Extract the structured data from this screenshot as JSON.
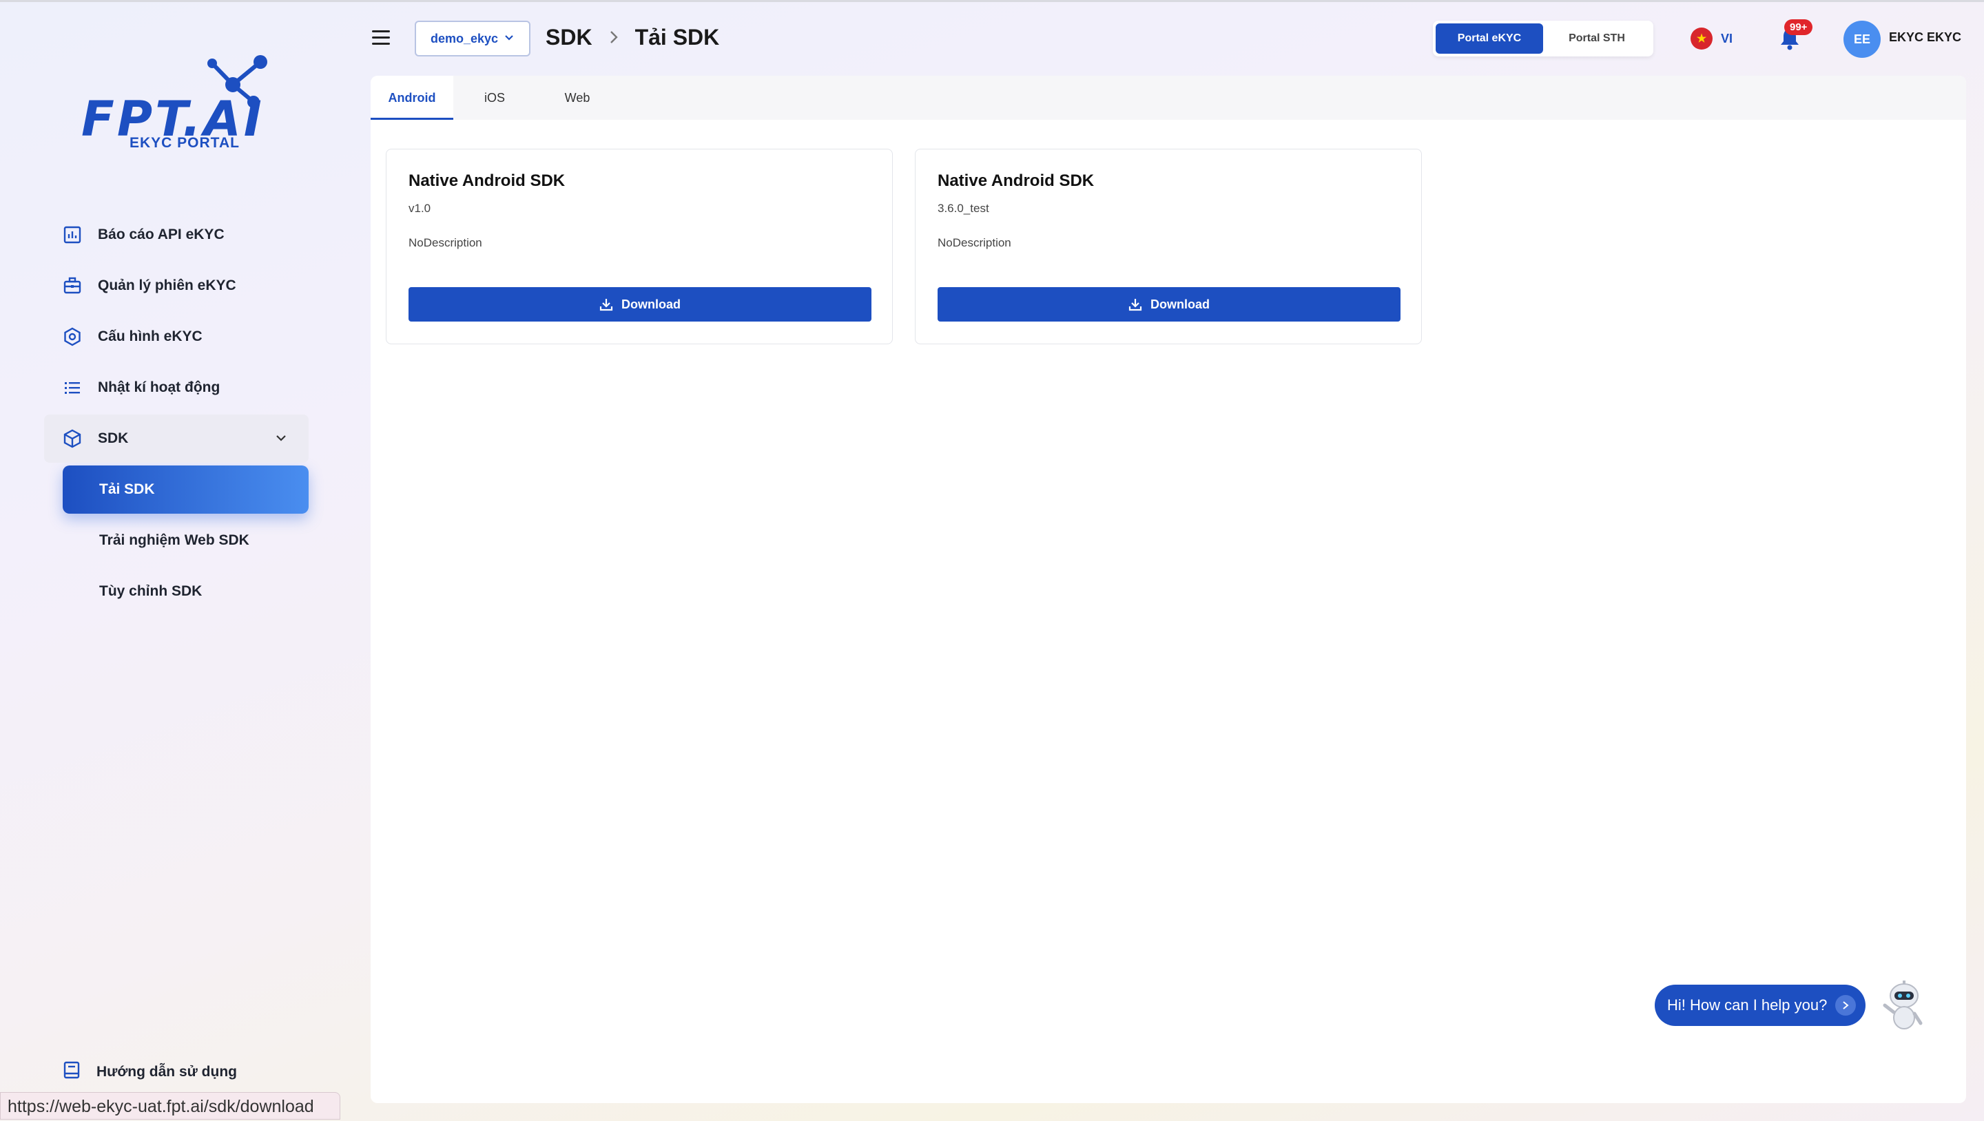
{
  "brand": {
    "logo_text": "FPT.AI",
    "logo_sub": "EKYC PORTAL",
    "color": "#1d4fc1"
  },
  "sidebar": {
    "items": [
      {
        "label": "Báo cáo API eKYC",
        "icon": "bar-chart-icon"
      },
      {
        "label": "Quản lý phiên eKYC",
        "icon": "briefcase-icon"
      },
      {
        "label": "Cấu hình eKYC",
        "icon": "settings-hex-icon"
      },
      {
        "label": "Nhật kí hoạt động",
        "icon": "list-icon"
      },
      {
        "label": "SDK",
        "icon": "box-icon"
      }
    ],
    "sdk_children": [
      {
        "label": "Tải SDK",
        "active": true
      },
      {
        "label": "Trải nghiệm Web SDK"
      },
      {
        "label": "Tùy chỉnh SDK"
      }
    ],
    "guide_label": "Hướng dẫn sử dụng"
  },
  "status_url": "https://web-ekyc-uat.fpt.ai/sdk/download",
  "header": {
    "project": "demo_ekyc",
    "breadcrumb": [
      "SDK",
      "Tải SDK"
    ],
    "portal_switch": [
      "Portal eKYC",
      "Portal STH"
    ],
    "lang": "VI",
    "notif_badge": "99+",
    "avatar_initials": "EE",
    "username": "EKYC EKYC"
  },
  "tabs": [
    "Android",
    "iOS",
    "Web"
  ],
  "cards": [
    {
      "title": "Native Android SDK",
      "version": "v1.0",
      "description": "NoDescription",
      "button": "Download"
    },
    {
      "title": "Native Android SDK",
      "version": "3.6.0_test",
      "description": "NoDescription",
      "button": "Download"
    }
  ],
  "chat": {
    "label": "Hi! How can I help you?"
  }
}
